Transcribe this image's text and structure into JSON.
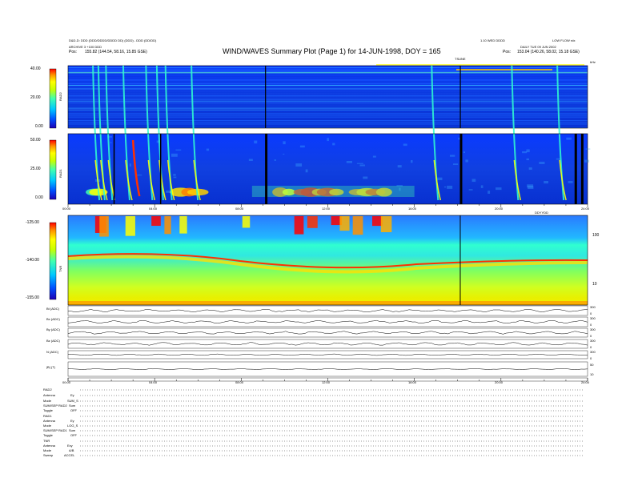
{
  "header": {
    "title": "WIND/WAVES Summary Plot (Page 1) for 14-JUN-1998, DOY = 165",
    "left_line1": "D&D-D: DDD (DDD/DDDD/DDDD DD) (DDD) - DDD (DD/DD)",
    "left_line2": "ARCHIVE 3 +100 DDD",
    "pos_left_label": "Pos:",
    "pos_left_value": "155.82 (144.54, 58.16, 15.85 GSE)",
    "right_line1": "1.10 WED DDDD",
    "right_line2": "DAILY TUE 09 JUN 2002",
    "right_line3": "LOW FLOW rdx",
    "pos_right_label": "Pos:",
    "pos_right_value": "153.04 (140.26, 58.02, 15.18 GSE)",
    "marker_label": "TSUNE",
    "hour_marker_label": "MIN",
    "freq_unit": "kHz"
  },
  "panels": {
    "rad2": {
      "name": "RAD2",
      "yticks": [
        "40.00",
        "20.00",
        "0.00"
      ]
    },
    "rad1": {
      "name": "RAD1",
      "yticks": [
        "50.00",
        "25.00",
        "0.00"
      ]
    },
    "tnr": {
      "name": "TNR",
      "yticks": [
        "-125.00",
        "-140.00",
        "-155.00"
      ],
      "right_ticks": [
        "100",
        "10"
      ]
    }
  },
  "time_axis": {
    "ticks": [
      "00:00",
      "04:00",
      "08:00",
      "12:00",
      "16:00",
      "20:00",
      "24:00"
    ],
    "extra_label": "DDYYDD"
  },
  "line_panels": [
    {
      "label": "Bt (ADC)",
      "scale": [
        "300",
        "0"
      ]
    },
    {
      "label": "Bx (ADC)",
      "scale": [
        "300",
        "0"
      ]
    },
    {
      "label": "By (ADC)",
      "scale": [
        "300",
        "0"
      ]
    },
    {
      "label": "Bz (ADC)",
      "scale": [
        "300",
        "0"
      ]
    },
    {
      "label": "N (ADC)",
      "scale": [
        "300",
        "0"
      ]
    },
    {
      "label": "|B| (T)",
      "scale": [
        "50",
        "10"
      ]
    }
  ],
  "status": {
    "rad2": {
      "title": "RAD2",
      "rows": [
        {
          "k": "Antenna",
          "v": "Ey"
        },
        {
          "k": "Mode",
          "v": "SUM_S"
        },
        {
          "k": "SUM/SEP RAD2",
          "v": "Sum"
        },
        {
          "k": "Toggle",
          "v": "OFF"
        }
      ]
    },
    "rad1": {
      "title": "RAD1",
      "rows": [
        {
          "k": "Antenna",
          "v": "Ey"
        },
        {
          "k": "Mode",
          "v": "LOG_S"
        },
        {
          "k": "SUM/SEP RAD1",
          "v": "Sum"
        },
        {
          "k": "Toggle",
          "v": "OFF"
        }
      ]
    },
    "tnr": {
      "title": "TNR",
      "rows": [
        {
          "k": "Antenna",
          "v": "Exy"
        },
        {
          "k": "Mode",
          "v": "A/B"
        },
        {
          "k": "Sweep",
          "v": "ACCEL"
        }
      ]
    }
  },
  "chart_data": {
    "type": "heatmap",
    "title": "WIND/WAVES Summary Plot (Page 1) for 14-JUN-1998, DOY = 165",
    "x_range_hours": [
      0,
      24
    ],
    "panels": [
      {
        "name": "RAD2",
        "ylim": [
          0,
          40
        ]
      },
      {
        "name": "RAD1",
        "ylim": [
          0,
          50
        ]
      },
      {
        "name": "TNR",
        "ylim": [
          -155,
          -125
        ]
      }
    ],
    "colorscale": [
      "#1e00b4",
      "#0050ff",
      "#00c8ff",
      "#40ffb0",
      "#c8ff00",
      "#ffff00",
      "#ff9000",
      "#ff0000"
    ],
    "data_gaps_hours": [
      9.1,
      18.1,
      23.4,
      23.7
    ],
    "type_iii_bursts_hours": [
      1.15,
      1.4,
      1.75,
      2.55,
      3.6,
      4.1,
      4.5,
      5.7,
      16.8,
      20.5,
      22.6
    ]
  }
}
